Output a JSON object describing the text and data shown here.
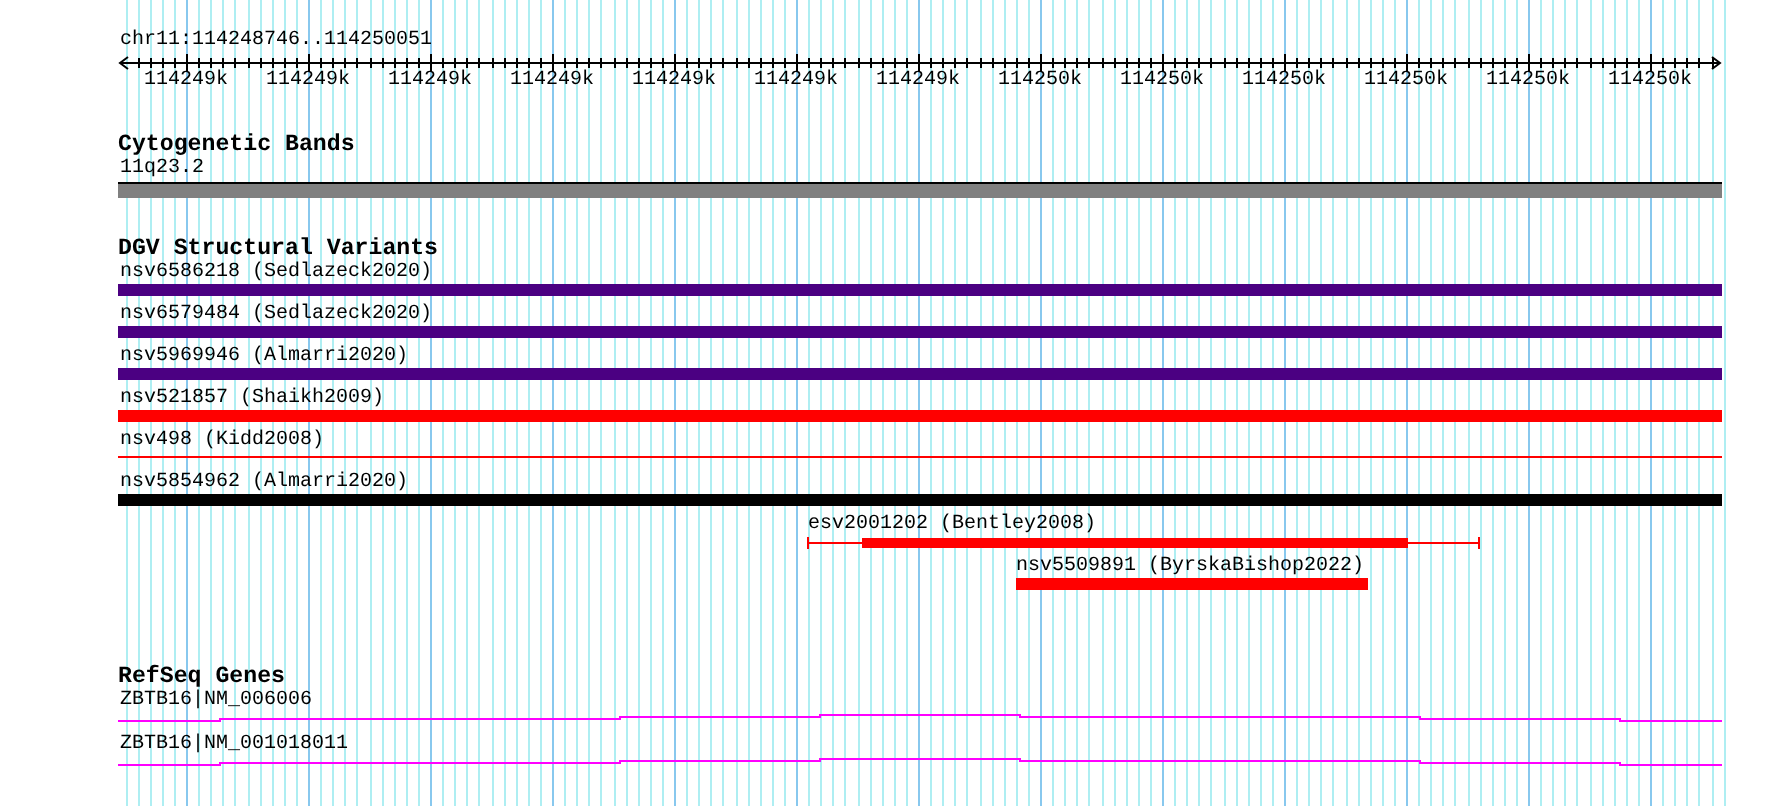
{
  "ruler": {
    "location": "chr11:114248746..114250051",
    "tick_labels": [
      "114249k",
      "114249k",
      "114249k",
      "114249k",
      "114249k",
      "114249k",
      "114249k",
      "114250k",
      "114250k",
      "114250k",
      "114250k",
      "114250k",
      "114250k"
    ]
  },
  "tracks": [
    {
      "title": "Cytogenetic Bands",
      "features": [
        {
          "label": "11q23.2",
          "kind": "band",
          "color": "#808080"
        }
      ]
    },
    {
      "title": "DGV Structural Variants",
      "features": [
        {
          "label": "nsv6586218 (Sedlazeck2020)",
          "kind": "full",
          "color": "#4b0082"
        },
        {
          "label": "nsv6579484 (Sedlazeck2020)",
          "kind": "full",
          "color": "#4b0082"
        },
        {
          "label": "nsv5969946 (Almarri2020)",
          "kind": "full",
          "color": "#4b0082"
        },
        {
          "label": "nsv521857 (Shaikh2009)",
          "kind": "full",
          "color": "#ff0000"
        },
        {
          "label": "nsv498 (Kidd2008)",
          "kind": "line",
          "color": "#ff0000"
        },
        {
          "label": "nsv5854962 (Almarri2020)",
          "kind": "full",
          "color": "#000000"
        },
        {
          "label": "esv2001202 (Bentley2008)",
          "kind": "gapped",
          "color": "#ff0000"
        },
        {
          "label": "nsv5509891 (ByrskaBishop2022)",
          "kind": "partial",
          "color": "#ff0000"
        }
      ]
    },
    {
      "title": "RefSeq Genes",
      "features": [
        {
          "label": "ZBTB16|NM_006006",
          "kind": "gene",
          "color": "#ff00ff"
        },
        {
          "label": "ZBTB16|NM_001018011",
          "kind": "gene",
          "color": "#ff00ff"
        }
      ]
    }
  ]
}
